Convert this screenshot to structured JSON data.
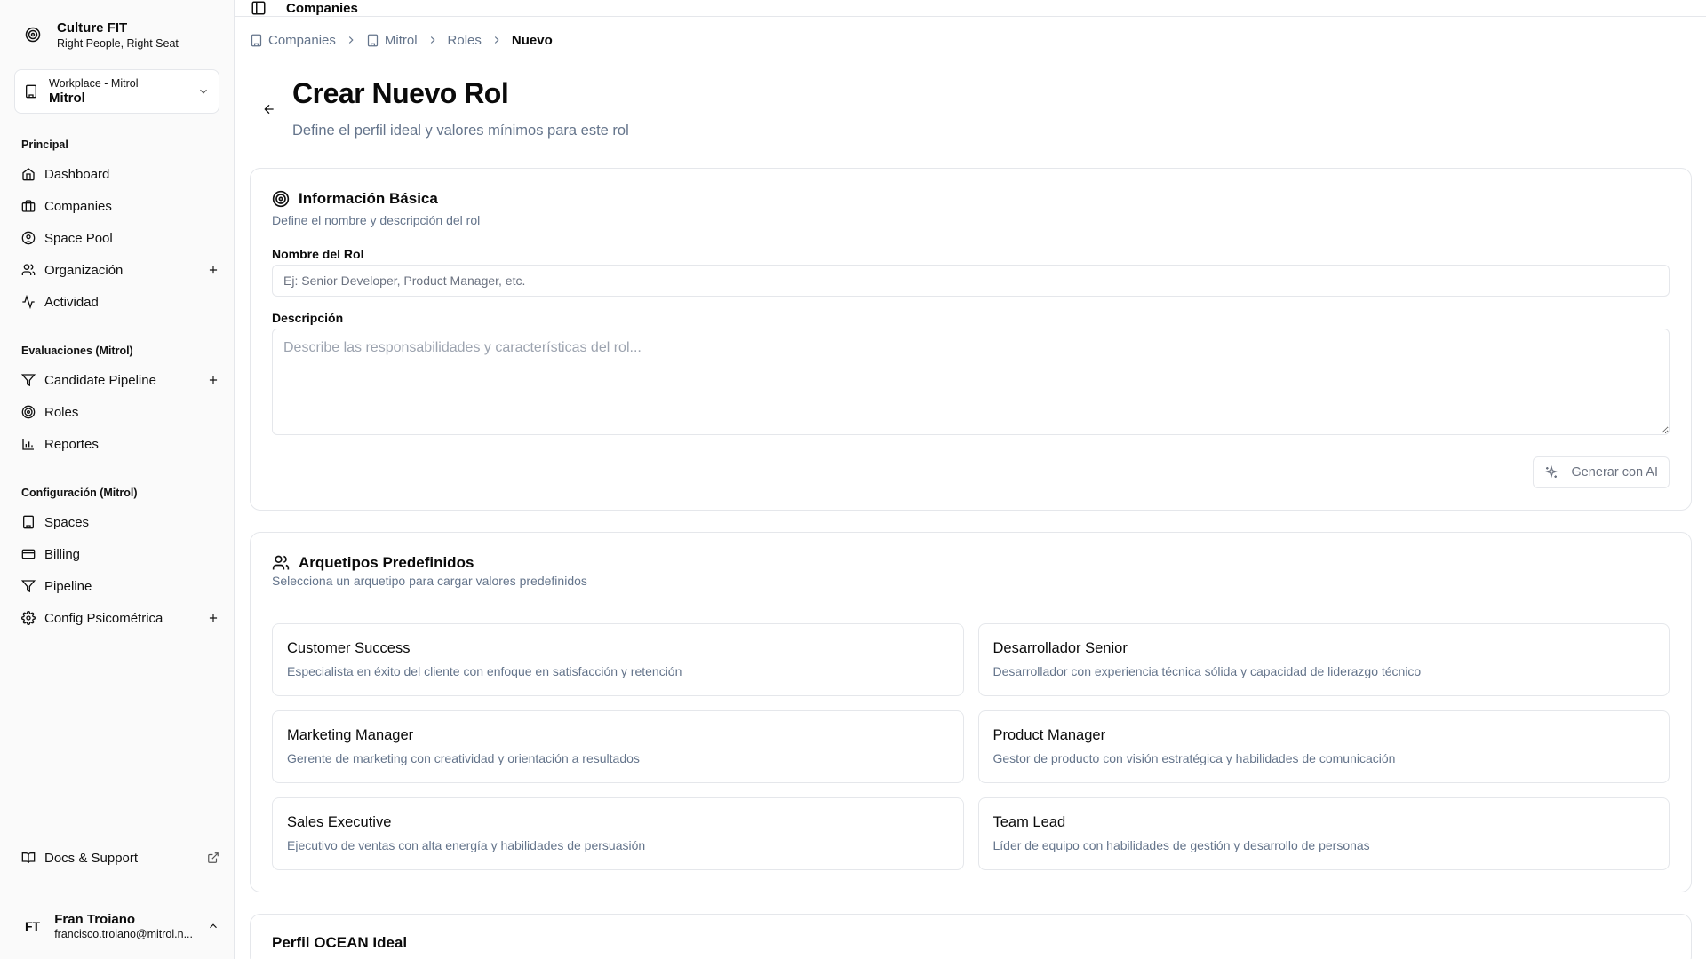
{
  "brand": {
    "name": "Culture FIT",
    "tagline": "Right People, Right Seat"
  },
  "workspace": {
    "label": "Workplace - Mitrol",
    "name": "Mitrol"
  },
  "sidebar": {
    "sections": [
      {
        "title": "Principal",
        "items": [
          {
            "label": "Dashboard",
            "icon": "home-icon"
          },
          {
            "label": "Companies",
            "icon": "building-icon"
          },
          {
            "label": "Space Pool",
            "icon": "circle-user-icon"
          },
          {
            "label": "Organización",
            "icon": "users-icon",
            "has_add": true
          },
          {
            "label": "Actividad",
            "icon": "activity-icon"
          }
        ]
      },
      {
        "title": "Evaluaciones (Mitrol)",
        "items": [
          {
            "label": "Candidate Pipeline",
            "icon": "filter-icon",
            "has_add": true
          },
          {
            "label": "Roles",
            "icon": "target-icon"
          },
          {
            "label": "Reportes",
            "icon": "bar-chart-icon"
          }
        ]
      },
      {
        "title": "Configuración (Mitrol)",
        "items": [
          {
            "label": "Spaces",
            "icon": "building-icon"
          },
          {
            "label": "Billing",
            "icon": "credit-card-icon"
          },
          {
            "label": "Pipeline",
            "icon": "filter-icon"
          },
          {
            "label": "Config Psicométrica",
            "icon": "gear-icon",
            "has_add": true
          }
        ]
      }
    ],
    "docs_label": "Docs & Support"
  },
  "user": {
    "initials": "FT",
    "name": "Fran Troiano",
    "email": "francisco.troiano@mitrol.n..."
  },
  "topbar": {
    "title": "Companies"
  },
  "breadcrumb": {
    "companies": "Companies",
    "company": "Mitrol",
    "roles": "Roles",
    "current": "Nuevo"
  },
  "page": {
    "title": "Crear Nuevo Rol",
    "subtitle": "Define el perfil ideal y valores mínimos para este rol"
  },
  "basic_info": {
    "title": "Información Básica",
    "subtitle": "Define el nombre y descripción del rol",
    "name_label": "Nombre del Rol",
    "name_placeholder": "Ej: Senior Developer, Product Manager, etc.",
    "name_value": "",
    "desc_label": "Descripción",
    "desc_placeholder": "Describe las responsabilidades y características del rol...",
    "desc_value": "",
    "ai_button": "Generar con AI"
  },
  "archetypes": {
    "title": "Arquetipos Predefinidos",
    "subtitle": "Selecciona un arquetipo para cargar valores predefinidos",
    "items": [
      {
        "name": "Customer Success",
        "desc": "Especialista en éxito del cliente con enfoque en satisfacción y retención"
      },
      {
        "name": "Desarrollador Senior",
        "desc": "Desarrollador con experiencia técnica sólida y capacidad de liderazgo técnico"
      },
      {
        "name": "Marketing Manager",
        "desc": "Gerente de marketing con creatividad y orientación a resultados"
      },
      {
        "name": "Product Manager",
        "desc": "Gestor de producto con visión estratégica y habilidades de comunicación"
      },
      {
        "name": "Sales Executive",
        "desc": "Ejecutivo de ventas con alta energía y habilidades de persuasión"
      },
      {
        "name": "Team Lead",
        "desc": "Líder de equipo con habilidades de gestión y desarrollo de personas"
      }
    ]
  },
  "ocean": {
    "title": "Perfil OCEAN Ideal"
  }
}
